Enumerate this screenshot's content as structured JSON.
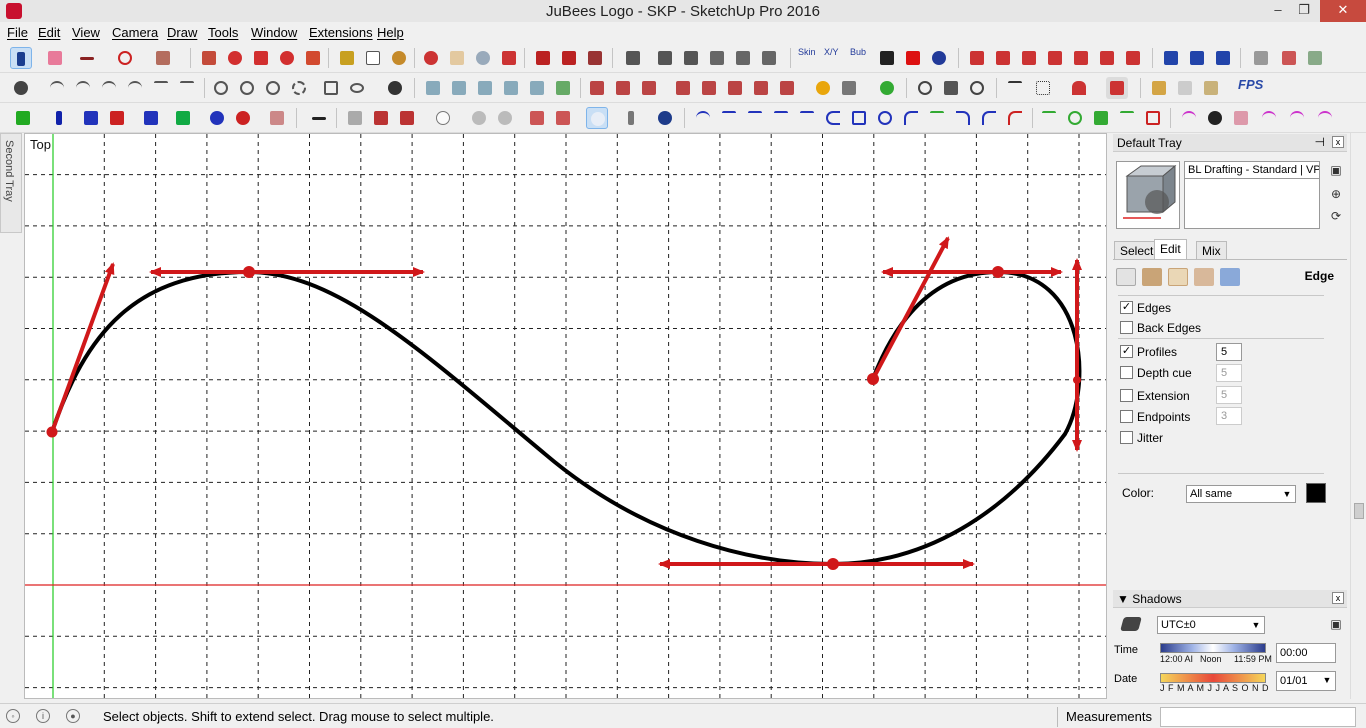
{
  "window": {
    "title": "JuBees Logo - SKP - SketchUp Pro 2016",
    "minimize": "–",
    "maximize": "❐",
    "close": "✕"
  },
  "menu": [
    "File",
    "Edit",
    "View",
    "Camera",
    "Draw",
    "Tools",
    "Window",
    "Extensions",
    "Help"
  ],
  "toolbar_top_text": {
    "skin": "Skin",
    "xyz": "X/Y",
    "bub": "Bub"
  },
  "toolbar_fps": "FPS",
  "second_tray": "Second Tray",
  "viewport": {
    "view_label": "Top",
    "curve_color": "#000000",
    "arrow_color": "#d0181a",
    "axis_green": "#22cc22",
    "axis_red": "#dd2222"
  },
  "default_tray": {
    "title": "Default Tray",
    "pin": "⊣",
    "close": "x",
    "style_name": "BL Drafting - Standard | VP",
    "tabs": [
      "Select",
      "Edit",
      "Mix"
    ],
    "active_tab": "Edit",
    "section": "Edge",
    "options": [
      {
        "label": "Edges",
        "checked": true,
        "value": null
      },
      {
        "label": "Back Edges",
        "checked": false,
        "value": null
      },
      {
        "label": "Profiles",
        "checked": true,
        "value": "5"
      },
      {
        "label": "Depth cue",
        "checked": false,
        "value": "5"
      },
      {
        "label": "Extension",
        "checked": false,
        "value": "5"
      },
      {
        "label": "Endpoints",
        "checked": false,
        "value": "3"
      },
      {
        "label": "Jitter",
        "checked": false,
        "value": null
      }
    ],
    "color_label": "Color:",
    "color_value": "All same",
    "color_swatch": "#000000"
  },
  "shadows": {
    "title": "Shadows",
    "timezone": "UTC±0",
    "time_label": "Time",
    "date_label": "Date",
    "time_ticks": [
      "12:00 AI",
      "Noon",
      "11:59 PM"
    ],
    "date_ticks": "J F M A M J J A S O N D",
    "time_value": "00:00",
    "date_value": "01/01"
  },
  "status": {
    "message": "Select objects. Shift to extend select. Drag mouse to select multiple.",
    "measurements_label": "Measurements",
    "measurements_value": ""
  }
}
